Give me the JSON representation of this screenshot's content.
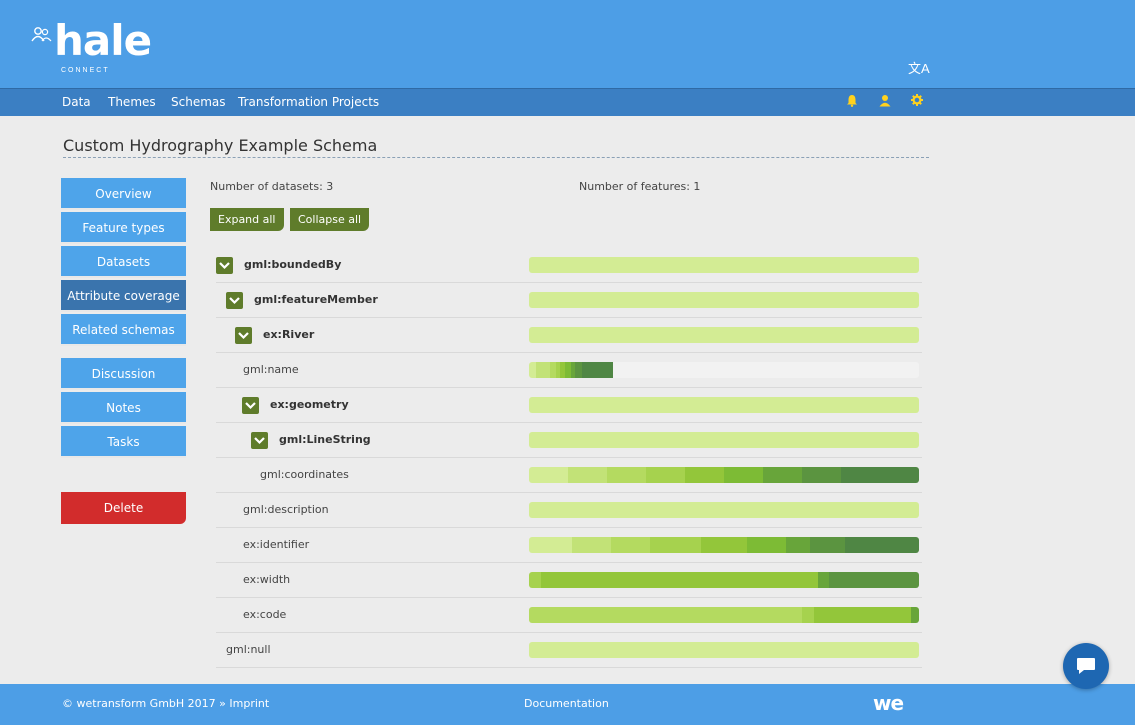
{
  "brand": {
    "logo_text": "hale",
    "logo_sub": "CONNECT",
    "lang_icon": "translate-icon"
  },
  "nav": {
    "links": [
      "Data",
      "Themes",
      "Schemas",
      "Transformation Projects"
    ],
    "icons": [
      "bell-icon",
      "user-icon",
      "gear-icon"
    ]
  },
  "page": {
    "title": "Custom Hydrography Example Schema"
  },
  "sidebar": {
    "group1": [
      "Overview",
      "Feature types",
      "Datasets",
      "Attribute coverage",
      "Related schemas"
    ],
    "group2": [
      "Discussion",
      "Notes",
      "Tasks"
    ],
    "active": "Attribute coverage",
    "delete_label": "Delete"
  },
  "stats": {
    "datasets": "Number of datasets: 3",
    "features": "Number of features: 1"
  },
  "buttons": {
    "expand_all": "Expand all",
    "collapse_all": "Collapse all"
  },
  "coverage_colors": [
    "#d3ec94",
    "#c2e277",
    "#b4da60",
    "#a6d24e",
    "#93c63a",
    "#7dbb35",
    "#68a53a",
    "#5b9440",
    "#4f8644"
  ],
  "tree": [
    {
      "label": "gml:boundedBy",
      "expandable": true,
      "segments": [
        [
          1.0,
          "#d3ec94"
        ]
      ]
    },
    {
      "label": "gml:featureMember",
      "expandable": true,
      "segments": [
        [
          1.0,
          "#d3ec94"
        ]
      ]
    },
    {
      "label": "ex:River",
      "expandable": true,
      "segments": [
        [
          1.0,
          "#d3ec94"
        ]
      ]
    },
    {
      "label": "gml:name",
      "expandable": false,
      "segments": [
        [
          0.018,
          "#d3ec94"
        ],
        [
          0.035,
          "#c2e277"
        ],
        [
          0.015,
          "#b4da60"
        ],
        [
          0.012,
          "#a6d24e"
        ],
        [
          0.012,
          "#93c63a"
        ],
        [
          0.015,
          "#7dbb35"
        ],
        [
          0.012,
          "#68a53a"
        ],
        [
          0.016,
          "#5b9440"
        ],
        [
          0.08,
          "#4f8644"
        ]
      ]
    },
    {
      "label": "ex:geometry",
      "expandable": true,
      "segments": [
        [
          1.0,
          "#d3ec94"
        ]
      ]
    },
    {
      "label": "gml:LineString",
      "expandable": true,
      "segments": [
        [
          1.0,
          "#d3ec94"
        ]
      ]
    },
    {
      "label": "gml:coordinates",
      "expandable": false,
      "segments": [
        [
          0.1,
          "#d3ec94"
        ],
        [
          0.1,
          "#c2e277"
        ],
        [
          0.1,
          "#b4da60"
        ],
        [
          0.1,
          "#a6d24e"
        ],
        [
          0.1,
          "#93c63a"
        ],
        [
          0.1,
          "#7dbb35"
        ],
        [
          0.1,
          "#68a53a"
        ],
        [
          0.1,
          "#5b9440"
        ],
        [
          0.1,
          "#4f8644"
        ],
        [
          0.1,
          "#4f8644"
        ]
      ]
    },
    {
      "label": "gml:description",
      "expandable": false,
      "segments": [
        [
          1.0,
          "#d3ec94"
        ]
      ]
    },
    {
      "label": "ex:identifier",
      "expandable": false,
      "segments": [
        [
          0.11,
          "#d3ec94"
        ],
        [
          0.1,
          "#c2e277"
        ],
        [
          0.1,
          "#b4da60"
        ],
        [
          0.13,
          "#a6d24e"
        ],
        [
          0.12,
          "#93c63a"
        ],
        [
          0.1,
          "#7dbb35"
        ],
        [
          0.06,
          "#68a53a"
        ],
        [
          0.09,
          "#5b9440"
        ],
        [
          0.1,
          "#4f8644"
        ],
        [
          0.09,
          "#4f8644"
        ]
      ]
    },
    {
      "label": "ex:width",
      "expandable": false,
      "segments": [
        [
          0.03,
          "#a6d24e"
        ],
        [
          0.71,
          "#93c63a"
        ],
        [
          0.03,
          "#68a53a"
        ],
        [
          0.23,
          "#5b9440"
        ]
      ]
    },
    {
      "label": "ex:code",
      "expandable": false,
      "segments": [
        [
          0.7,
          "#b4da60"
        ],
        [
          0.03,
          "#a6d24e"
        ],
        [
          0.25,
          "#93c63a"
        ],
        [
          0.02,
          "#68a53a"
        ]
      ]
    },
    {
      "label": "gml:null",
      "expandable": false,
      "segments": [
        [
          1.0,
          "#d3ec94"
        ]
      ]
    }
  ],
  "footer": {
    "copyright": "© wetransform GmbH 2017 » Imprint",
    "documentation": "Documentation",
    "logo": "we"
  },
  "chat_icon": "chat-bubble-icon"
}
